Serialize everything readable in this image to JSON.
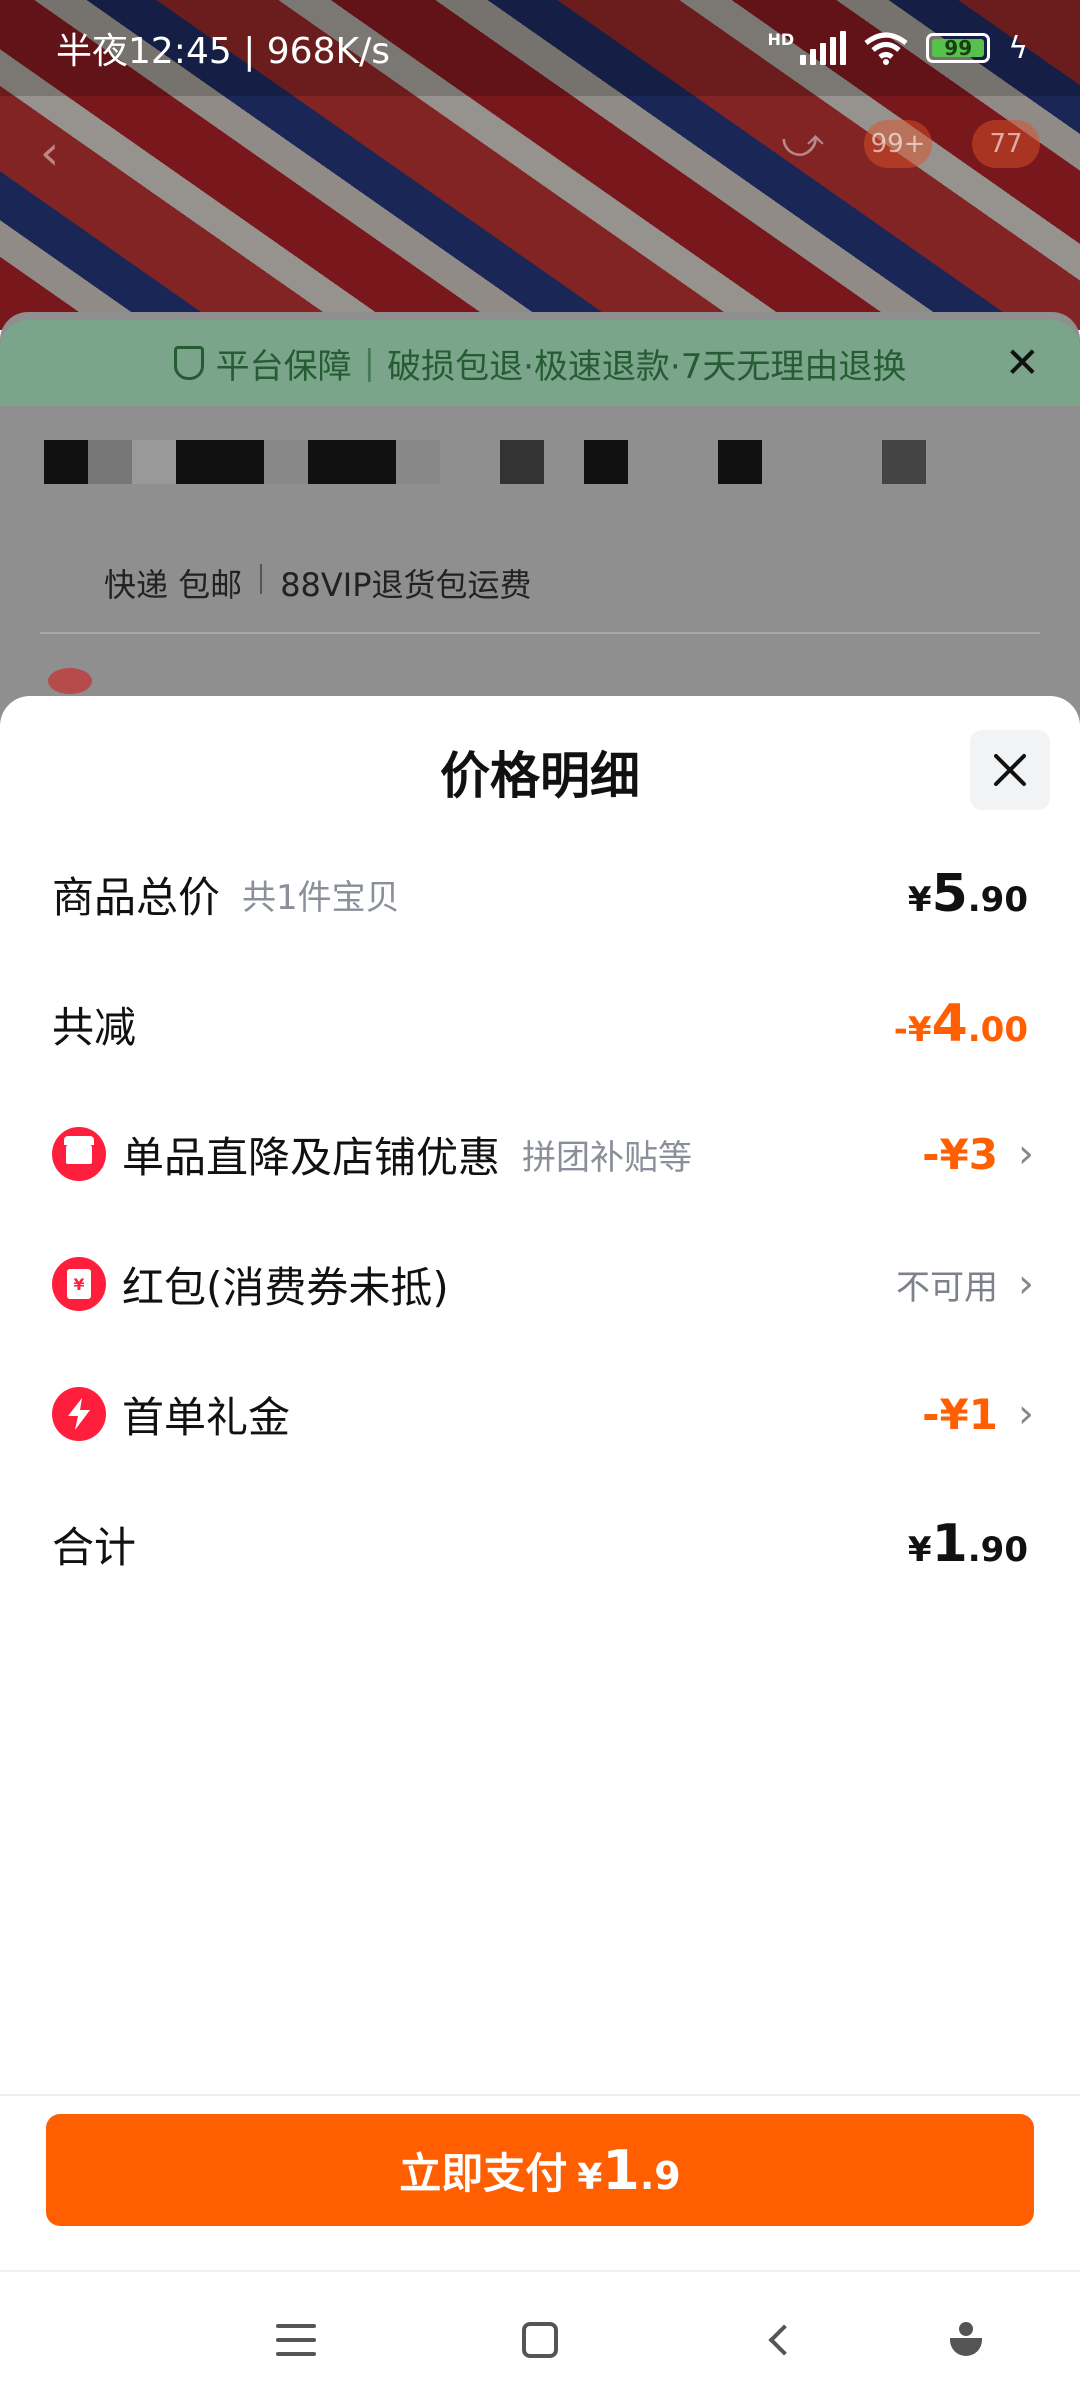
{
  "status_bar": {
    "time_speed": "半夜12:45 | 968K/s",
    "hd_label": "HD",
    "battery": "99"
  },
  "background_page": {
    "nav_badges": [
      "99+",
      "77"
    ],
    "guarantee": {
      "title": "平台保障",
      "text": "破损包退·极速退款·7天无理由退换"
    },
    "shipping": {
      "method": "快递 包邮",
      "note": "88VIP退货包运费"
    }
  },
  "sheet": {
    "title": "价格明细",
    "rows": {
      "total": {
        "label": "商品总价",
        "sub": "共1件宝贝",
        "yen": "¥",
        "int": "5",
        "dec": ".90"
      },
      "discount": {
        "label": "共减",
        "prefix": "-¥",
        "int": "4",
        "dec": ".00"
      },
      "store_discount": {
        "label": "单品直降及店铺优惠",
        "sub": "拼团补贴等",
        "value": "-¥3"
      },
      "red_packet": {
        "label": "红包(消费券未抵)",
        "value": "不可用",
        "icon_text": "¥"
      },
      "first_order": {
        "label": "首单礼金",
        "value": "-¥1"
      },
      "sum": {
        "label": "合计",
        "yen": "¥",
        "int": "1",
        "dec": ".90"
      }
    }
  },
  "pay_button": {
    "label": "立即支付",
    "yen": "¥",
    "int": "1",
    "dec": ".9"
  },
  "icons": {
    "store": "store-icon",
    "red_packet": "red-packet-icon",
    "first_order": "lightning-icon",
    "close": "close-icon",
    "chevron": "chevron-right-icon"
  },
  "colors": {
    "accent": "#ff5f00",
    "icon_red": "#ff1f3d",
    "guarantee_green": "#255c33"
  }
}
